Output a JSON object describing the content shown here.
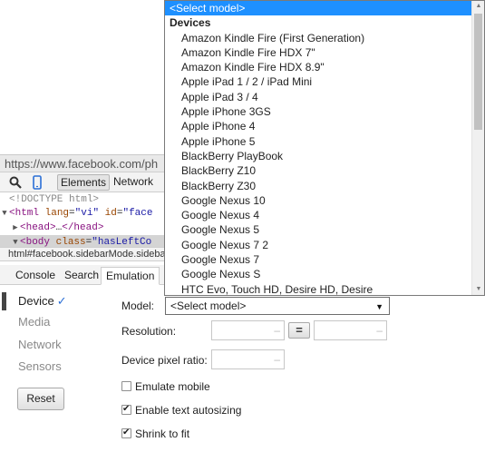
{
  "browser": {
    "url_text": "https://www.facebook.com/ph"
  },
  "devtools": {
    "tabs": [
      "Elements",
      "Network"
    ],
    "icons": {
      "search": "magnifier-icon",
      "device": "mobile-device-icon"
    },
    "dom_tree": {
      "doctype": "<!DOCTYPE html>",
      "html_line": {
        "tag_open": "<html",
        "attr1": "lang",
        "val1": "\"vi\"",
        "attr2": "id",
        "val2": "\"face"
      },
      "head_line": {
        "tag": "<head>",
        "ellipsis": "…",
        "close": "</head>"
      },
      "body_line": {
        "tag_open": "<body",
        "attr": "class",
        "val": "\"hasLeftCo"
      }
    },
    "breadcrumb": "html#facebook.sidebarMode.sidebar",
    "drawer_tabs": {
      "console": "Console",
      "search": "Search",
      "emulation": "Emulation"
    }
  },
  "emulation": {
    "sidebar": {
      "device": "Device",
      "device_check": "✓",
      "media": "Media",
      "network": "Network",
      "sensors": "Sensors",
      "reset": "Reset"
    },
    "model_label": "Model:",
    "model_value": "<Select model>",
    "resolution_label": "Resolution:",
    "swap_symbol": "=",
    "dpr_label": "Device pixel ratio:",
    "dash": "–",
    "checkboxes": {
      "emulate_mobile": {
        "label": "Emulate mobile",
        "checked": false
      },
      "text_autosizing": {
        "label": "Enable text autosizing",
        "checked": true
      },
      "shrink_to_fit": {
        "label": "Shrink to fit",
        "checked": true
      }
    }
  },
  "dropdown": {
    "selected": "<Select model>",
    "group": "Devices",
    "options": [
      "Amazon Kindle Fire (First Generation)",
      "Amazon Kindle Fire HDX 7\"",
      "Amazon Kindle Fire HDX 8.9\"",
      "Apple iPad 1 / 2 / iPad Mini",
      "Apple iPad 3 / 4",
      "Apple iPhone 3GS",
      "Apple iPhone 4",
      "Apple iPhone 5",
      "BlackBerry PlayBook",
      "BlackBerry Z10",
      "BlackBerry Z30",
      "Google Nexus 10",
      "Google Nexus 4",
      "Google Nexus 5",
      "Google Nexus 7 2",
      "Google Nexus 7",
      "Google Nexus S",
      "HTC Evo, Touch HD, Desire HD, Desire"
    ]
  }
}
